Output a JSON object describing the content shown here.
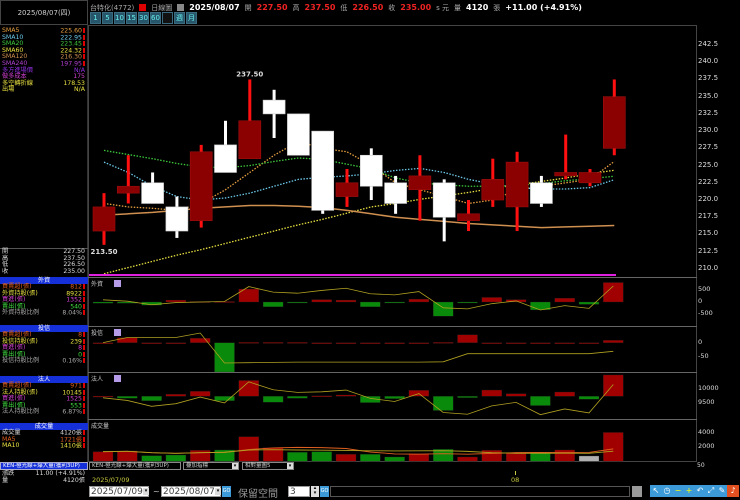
{
  "header": {
    "date_box": "2025/08/07(四)",
    "stock": "台特化(4772)",
    "chart_type": "日線圖",
    "date": "2025/08/07",
    "open_label": "開",
    "open": "227.50",
    "high_label": "高",
    "high": "237.50",
    "low_label": "低",
    "low": "226.50",
    "close_label": "收",
    "close": "235.00",
    "unit": "s 元",
    "volume_label": "量",
    "volume": "4120",
    "volume_unit": "張",
    "change": "+11.00 (+4.91%)",
    "period_buttons": [
      "1",
      "5",
      "10",
      "15",
      "30",
      "60",
      "",
      "週",
      "月"
    ]
  },
  "left": {
    "ma": [
      {
        "label": "SMA5",
        "value": "225.60",
        "color": "#e8a040"
      },
      {
        "label": "SMA10",
        "value": "222.95",
        "color": "#6cc8e8"
      },
      {
        "label": "SMA20",
        "value": "223.45",
        "color": "#3cc83c"
      },
      {
        "label": "SMA60",
        "value": "224.32",
        "color": "#e8e040"
      },
      {
        "label": "SMA120",
        "value": "216.30",
        "color": "#d09050"
      },
      {
        "label": "SMA240",
        "value": "197.95",
        "color": "#b040d0"
      }
    ],
    "levels": [
      {
        "label": "多方進場價",
        "value": "N/A",
        "color": "#9030e0"
      },
      {
        "label": "做多成本",
        "value": "175",
        "color": "#d040d0"
      },
      {
        "label": "多空轉折線",
        "value": "178.53",
        "color": "#e8e040"
      },
      {
        "label": "出場",
        "value": "N/A",
        "color": "#e8e040"
      }
    ],
    "ohlc": [
      {
        "label": "開",
        "value": "227.50"
      },
      {
        "label": "高",
        "value": "237.50"
      },
      {
        "label": "低",
        "value": "226.50"
      },
      {
        "label": "收",
        "value": "235.00"
      }
    ],
    "foreign": {
      "title": "外資",
      "rows": [
        {
          "label": "買賣超(張)",
          "value": "812",
          "color": "#e06020"
        },
        {
          "label": "外資持股(張)",
          "value": "8922",
          "color": "#e8e040"
        },
        {
          "label": "買進(張)",
          "value": "1352",
          "color": "#d040d0"
        },
        {
          "label": "賣出(張)",
          "value": "540",
          "color": "#40e040"
        },
        {
          "label": "外資持股比例",
          "value": "8.04%",
          "color": "#aaaaaa"
        }
      ]
    },
    "trust": {
      "title": "投信",
      "rows": [
        {
          "label": "買賣超(張)",
          "value": "8",
          "color": "#e06020"
        },
        {
          "label": "投信持股(張)",
          "value": "239",
          "color": "#e8e040"
        },
        {
          "label": "買進(張)",
          "value": "8",
          "color": "#d040d0"
        },
        {
          "label": "賣出(張)",
          "value": "0",
          "color": "#40e040"
        },
        {
          "label": "投信持股比例",
          "value": "0.16%",
          "color": "#aaaaaa"
        }
      ]
    },
    "inst": {
      "title": "法人",
      "rows": [
        {
          "label": "買賣超(張)",
          "value": "971",
          "color": "#e06020"
        },
        {
          "label": "法人持股(張)",
          "value": "10145",
          "color": "#e8e040"
        },
        {
          "label": "買進(張)",
          "value": "1525",
          "color": "#d040d0"
        },
        {
          "label": "賣出(張)",
          "value": "553",
          "color": "#40e040"
        },
        {
          "label": "法人持股比例",
          "value": "6.87%",
          "color": "#aaaaaa"
        }
      ]
    },
    "vol": {
      "title": "成交量",
      "rows": [
        {
          "label": "成交量",
          "value": "4120張",
          "color": "#dddddd"
        },
        {
          "label": "MA5",
          "value": "1721張",
          "color": "#e06020"
        },
        {
          "label": "MA10",
          "value": "1410張",
          "color": "#e8e040"
        }
      ]
    },
    "indicator": "KEN-極光線+爆大量(獲利3UP)",
    "summary": [
      {
        "label": "漲跌",
        "value": "11.00 (+4.91%)"
      },
      {
        "label": "量",
        "value": "4120張"
      }
    ]
  },
  "chart_data": [
    {
      "type": "candlestick",
      "title": "",
      "ylim": [
        208.5,
        244
      ],
      "yticks": [
        "242.5",
        "240.0",
        "237.5",
        "235.0",
        "232.5",
        "230.0",
        "227.5",
        "225.0",
        "222.5",
        "220.0",
        "217.5",
        "215.0",
        "212.5",
        "210.0"
      ],
      "annotations": {
        "high": "237.50",
        "low": "213.50"
      },
      "x_ticks": [
        "2025/07/09",
        "08"
      ],
      "open": [
        215.5,
        221,
        222.5,
        219,
        217,
        228,
        226,
        234.5,
        232.5,
        230,
        220.5,
        226.5,
        222.5,
        221.5,
        222.5,
        217,
        220,
        219,
        222.5,
        223.5,
        222.5,
        227.5
      ],
      "high": [
        221,
        226.5,
        224,
        220.5,
        228,
        231.5,
        237.5,
        236,
        232.5,
        230,
        224.5,
        227.5,
        223.5,
        226.5,
        223,
        220,
        226,
        227,
        223.5,
        229.5,
        224.5,
        237.5
      ],
      "low": [
        213.5,
        219.5,
        219.5,
        214.5,
        216,
        224,
        226,
        229,
        226.5,
        218,
        219,
        220,
        218,
        217,
        214,
        215.5,
        219,
        215.5,
        219,
        223,
        222,
        226.5
      ],
      "close": [
        219,
        222,
        219.5,
        215.5,
        227,
        224,
        231.5,
        232.5,
        226.5,
        218.5,
        222.5,
        222,
        219.5,
        223.5,
        217.5,
        218,
        223,
        225.5,
        219.5,
        224,
        224,
        235
      ],
      "series": [
        {
          "name": "SMA5",
          "color": "#e8a040",
          "values": [
            219.5,
            219,
            218.8,
            218.5,
            219.5,
            221.5,
            224,
            226.5,
            228.5,
            227.5,
            227,
            225,
            222.5,
            221.5,
            220.5,
            219.5,
            220,
            221.5,
            222,
            222.5,
            223,
            225.6
          ]
        },
        {
          "name": "SMA10",
          "color": "#6cc8e8",
          "values": [
            225.5,
            224,
            222,
            220.5,
            220,
            220.3,
            221,
            222,
            223,
            223.3,
            223.5,
            223.8,
            224.3,
            224.6,
            224,
            223,
            222.3,
            221.8,
            221.6,
            221.6,
            221.8,
            222.95
          ]
        },
        {
          "name": "SMA20",
          "color": "#3cc83c",
          "values": [
            227.2,
            226.6,
            226,
            225.3,
            224.8,
            224.7,
            225,
            225.6,
            226.1,
            225.9,
            225.2,
            224.5,
            223.2,
            222.5,
            222.2,
            222,
            222,
            222.1,
            222.4,
            222.8,
            223.1,
            223.45
          ]
        },
        {
          "name": "SMA60",
          "color": "#e8e040",
          "values": [
            209.3,
            210.2,
            211.1,
            212,
            212.8,
            213.7,
            214.6,
            215.5,
            216.4,
            217.2,
            218.1,
            219,
            219.5,
            220.1,
            220.6,
            221.1,
            221.7,
            222.2,
            222.7,
            223.2,
            223.8,
            224.32
          ]
        },
        {
          "name": "SMA120",
          "color": "#d09050",
          "values": [
            217.8,
            218,
            218.2,
            218.5,
            218.8,
            219,
            219.2,
            219.2,
            219.1,
            218.9,
            218.5,
            218,
            217.5,
            217.2,
            216.9,
            216.6,
            216.4,
            216.2,
            216,
            216.1,
            216.2,
            216.3
          ]
        }
      ]
    },
    {
      "type": "bar",
      "panel": "外資",
      "yticks": [
        "500",
        "0",
        "-500"
      ],
      "values": [
        -50,
        -50,
        -130,
        80,
        20,
        20,
        540,
        -200,
        -40,
        100,
        80,
        -200,
        -40,
        120,
        -590,
        -40,
        190,
        100,
        -330,
        160,
        -100,
        812
      ],
      "holding_last": 8922
    },
    {
      "type": "bar",
      "panel": "投信",
      "yticks": [
        "0",
        "-50"
      ],
      "values": [
        0,
        17,
        0,
        0,
        15,
        -100,
        1,
        1,
        1,
        0,
        0,
        0,
        0,
        0,
        1,
        27,
        0,
        0,
        0,
        0,
        0,
        8
      ],
      "holding_last": 239
    },
    {
      "type": "bar",
      "panel": "法人",
      "yticks": [
        "10000",
        "9500"
      ],
      "values": [
        10,
        -90,
        -200,
        90,
        225,
        -200,
        720,
        -270,
        -90,
        20,
        60,
        -285,
        -105,
        270,
        -645,
        -60,
        285,
        120,
        -420,
        195,
        -135,
        971
      ],
      "holding_last": 10145
    },
    {
      "type": "bar",
      "panel": "成交量",
      "yticks": [
        "4000",
        "2000"
      ],
      "values": [
        1380,
        1480,
        810,
        900,
        1570,
        1620,
        3520,
        1950,
        1290,
        1380,
        1000,
        1000,
        620,
        1100,
        1710,
        620,
        1570,
        1190,
        1190,
        1620,
        760,
        4120
      ],
      "colors": [
        "r",
        "r",
        "g",
        "g",
        "r",
        "g",
        "r",
        "r",
        "g",
        "g",
        "r",
        "g",
        "g",
        "r",
        "g",
        "r",
        "r",
        "r",
        "g",
        "r",
        "x",
        "r"
      ]
    }
  ],
  "strip": {
    "indicator_select": "KEN-極光線+爆大量(獲利3UP)",
    "overlay_select": "疊加指標",
    "relvol_select": "相對量圖5",
    "right_value": "50"
  },
  "bottom": {
    "start_date": "2025/07/09",
    "tilde": "~",
    "end_date": "2025/08/07",
    "go": "GO",
    "reserve_label": "保留空間",
    "reserve_value": "3"
  },
  "colors": {
    "up": "#8b0000",
    "up_wick": "#ff1010",
    "down": "#ffffff",
    "bar_up": "#a00000",
    "bar_down": "#0a8a0a",
    "accent": "#e020e0"
  }
}
